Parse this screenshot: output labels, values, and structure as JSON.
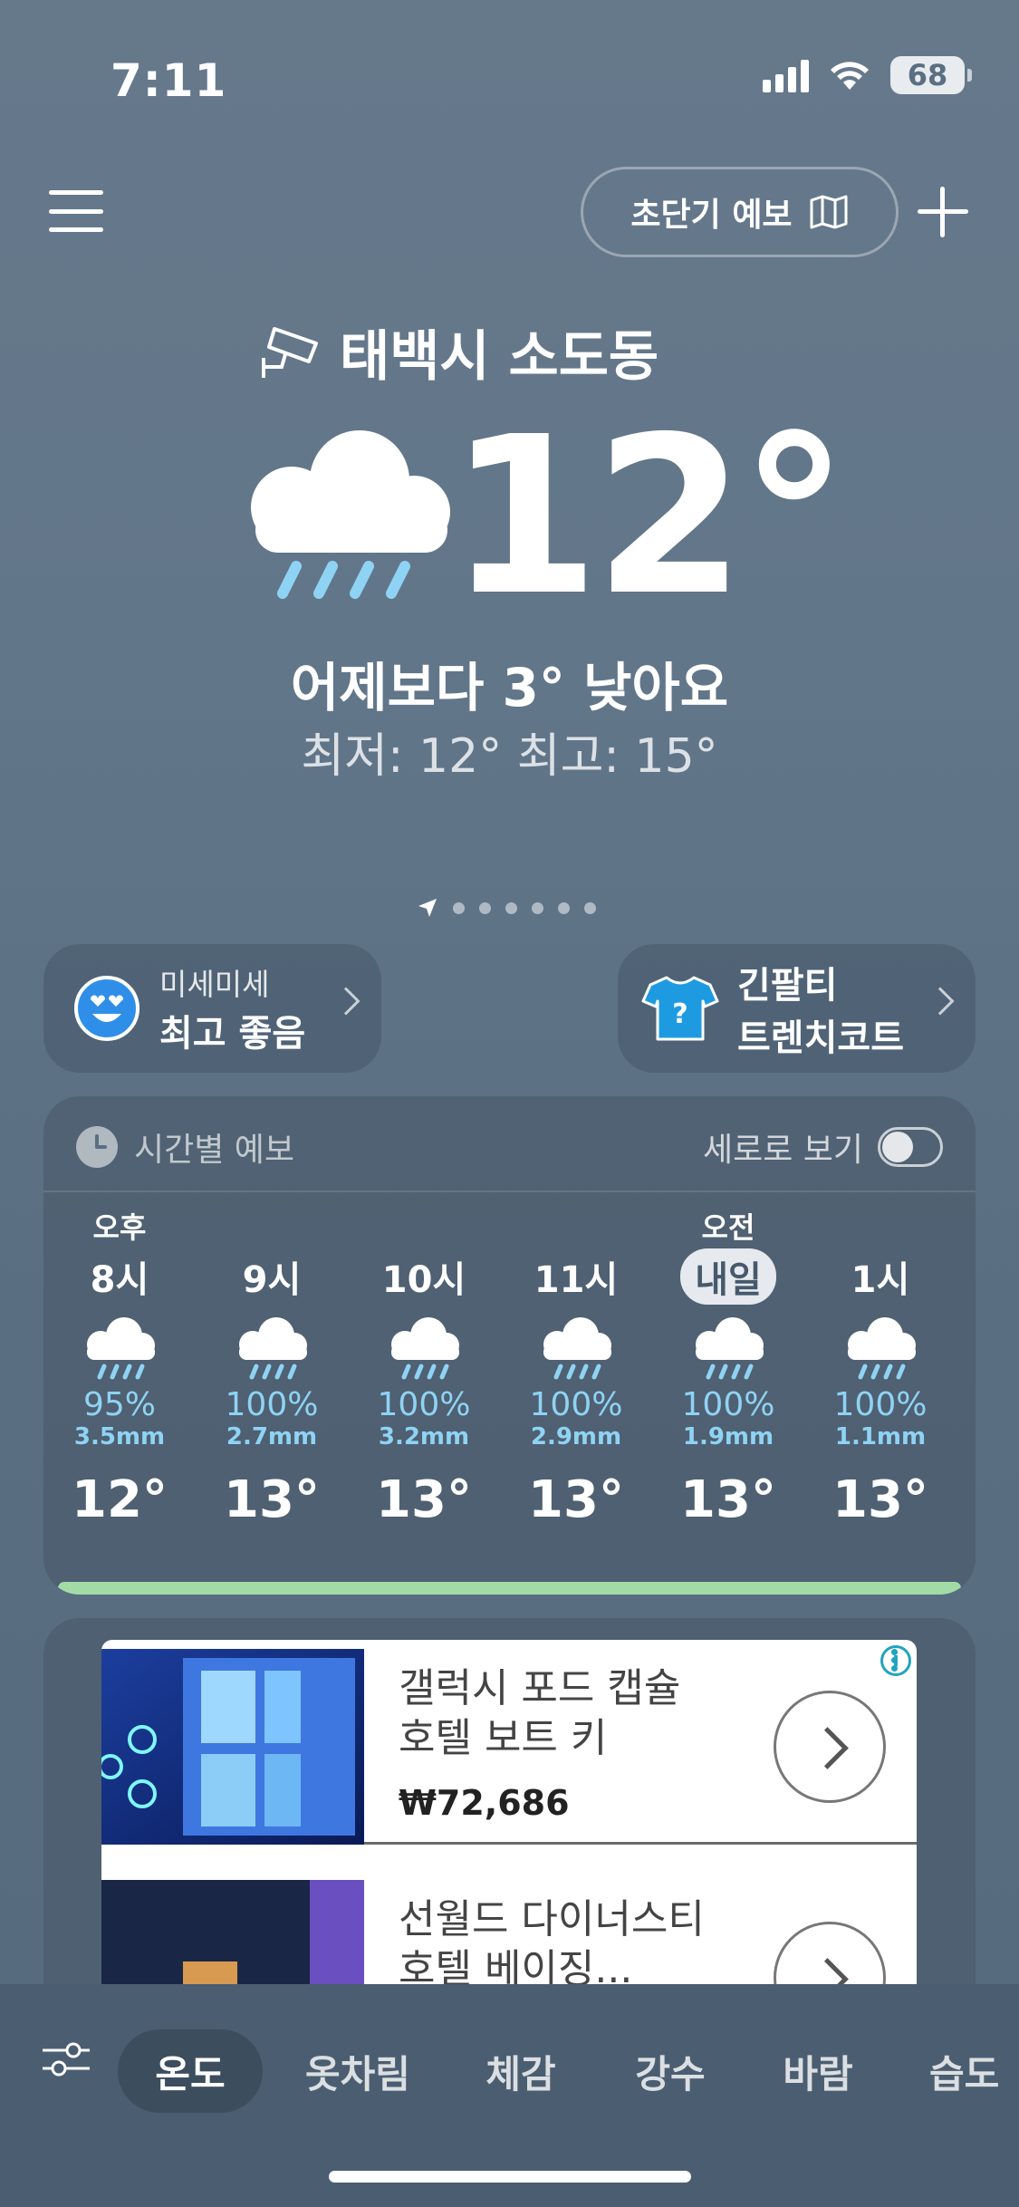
{
  "status_bar": {
    "time": "7:11",
    "battery": "68"
  },
  "header": {
    "forecast_button": "초단기 예보"
  },
  "location": {
    "name": "태백시 소도동"
  },
  "current": {
    "temperature": "12°",
    "comparison": "어제보다 3° 낮아요",
    "min_max": "최저: 12°  최고: 15°"
  },
  "page_indicator": {
    "count": 6,
    "active": 0
  },
  "cards": {
    "dust": {
      "label": "미세미세",
      "value": "최고 좋음"
    },
    "clothing": {
      "line1": "긴팔티",
      "line2": "트렌치코트"
    }
  },
  "hourly": {
    "title": "시간별 예보",
    "toggle_label": "세로로 보기",
    "items": [
      {
        "period": "오후",
        "hour": "8시",
        "pop": "95%",
        "mm": "3.5mm",
        "temp": "12°",
        "highlight": false
      },
      {
        "period": "",
        "hour": "9시",
        "pop": "100%",
        "mm": "2.7mm",
        "temp": "13°",
        "highlight": false
      },
      {
        "period": "",
        "hour": "10시",
        "pop": "100%",
        "mm": "3.2mm",
        "temp": "13°",
        "highlight": false
      },
      {
        "period": "",
        "hour": "11시",
        "pop": "100%",
        "mm": "2.9mm",
        "temp": "13°",
        "highlight": false
      },
      {
        "period": "오전",
        "hour": "내일",
        "pop": "100%",
        "mm": "1.9mm",
        "temp": "13°",
        "highlight": true
      },
      {
        "period": "",
        "hour": "1시",
        "pop": "100%",
        "mm": "1.1mm",
        "temp": "13°",
        "highlight": false
      }
    ]
  },
  "ads": {
    "items": [
      {
        "title_line1": "갤럭시 포드 캡슐",
        "title_line2": "호텔 보트 키",
        "price": "₩72,686"
      },
      {
        "title_line1": "선월드 다이너스티",
        "title_line2": "호텔 베이징...",
        "price": ""
      }
    ],
    "info_label": "i"
  },
  "tabbar": {
    "tabs": [
      "온도",
      "옷차림",
      "체감",
      "강수",
      "바람",
      "습도"
    ],
    "active": "온도"
  },
  "colors": {
    "rain": "#8fd3f4",
    "accent_green": "#a3dba6",
    "shirt": "#1e9be0",
    "dust_face": "#2f8fe8"
  }
}
